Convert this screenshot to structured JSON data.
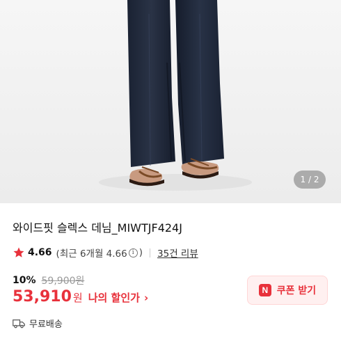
{
  "product": {
    "image_pager": "1 / 2",
    "title": "와이드핏 슬렉스 데님_MIWTJF424J"
  },
  "rating": {
    "icon": "star-icon",
    "value": "4.66",
    "recent_prefix": "(최근 6개월 4.66",
    "recent_suffix": ")",
    "info_glyph": "i",
    "reviews": "35건 리뷰"
  },
  "pricing": {
    "discount": "10%",
    "original_price": "59,900원",
    "price": "53,910",
    "currency": "원",
    "my_discount_label": "나의 할인가",
    "chevron": "›"
  },
  "coupon": {
    "badge": "N",
    "label": "쿠폰 받기"
  },
  "shipping": {
    "icon": "truck-icon",
    "label": "무료배송"
  },
  "colors": {
    "accent": "#e8313b",
    "star": "#e8313b",
    "coupon_bg": "#fff0f0"
  }
}
